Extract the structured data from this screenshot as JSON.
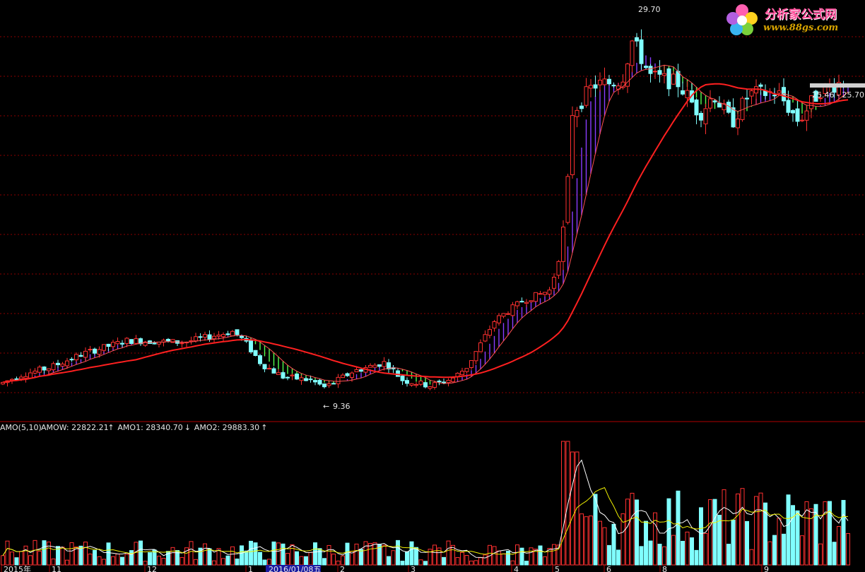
{
  "chart_data": {
    "type": "candlestick",
    "price_annotations": {
      "high_label": "29.70",
      "low_label": "9.36",
      "range_label": "25.46 - 25.70"
    },
    "volume_legend": {
      "name": "AMO(5,10)",
      "items": [
        {
          "label": "AMOW: 22822.21",
          "arrow": "↑",
          "color": "#ffffff"
        },
        {
          "label": "AMO1: 28340.70",
          "arrow": "↓",
          "color": "#f0f000"
        },
        {
          "label": "AMO2: 29883.30",
          "arrow": "↑",
          "color": "#ff40ff"
        }
      ]
    },
    "x_ticks": [
      "2015年",
      "11",
      "12",
      "1",
      "2016/01/08五",
      "2",
      "3",
      "4",
      "5",
      "6",
      "8",
      "9"
    ],
    "y_range": [
      8,
      31
    ],
    "colors": {
      "up": "#ff3030",
      "down": "#80ffff",
      "ma_long": "#ff2020",
      "band_up": "#8a3cff",
      "band_down": "#50ff50",
      "grid": "#8b0000"
    }
  },
  "logo": {
    "title": "分析家公式网",
    "url": "www.88gs.com"
  }
}
